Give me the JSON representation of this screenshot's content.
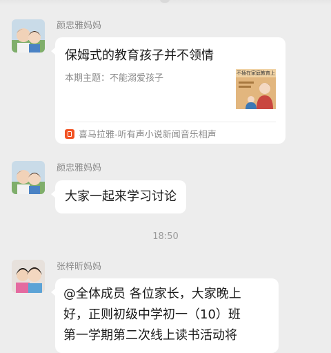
{
  "messages": [
    {
      "sender": "颜忠雅妈妈",
      "type": "link-card",
      "card": {
        "title": "保姆式的教育孩子并不领情",
        "description": "本期主题：不能溺爱孩子",
        "thumbnail_text": "不插在家庭教育上",
        "thumbnail_color": "#e2b67e",
        "source_icon": "ximalaya-icon",
        "source_icon_color": "#f25324",
        "source": "喜马拉雅-听有声小说新闻音乐相声"
      }
    },
    {
      "sender": "颜忠雅妈妈",
      "type": "text",
      "text": "大家一起来学习讨论"
    },
    {
      "sender": "张梓昕妈妈",
      "type": "text",
      "lines": [
        "@全体成员 各位家长，大家晚上",
        "好，正则初级中学初一（10）班",
        "第一学期第二次线上读书活动将"
      ]
    }
  ],
  "timestamp": "18:50",
  "colors": {
    "background": "#ededed",
    "bubble": "#ffffff",
    "sender_name": "#8a8a8a"
  }
}
